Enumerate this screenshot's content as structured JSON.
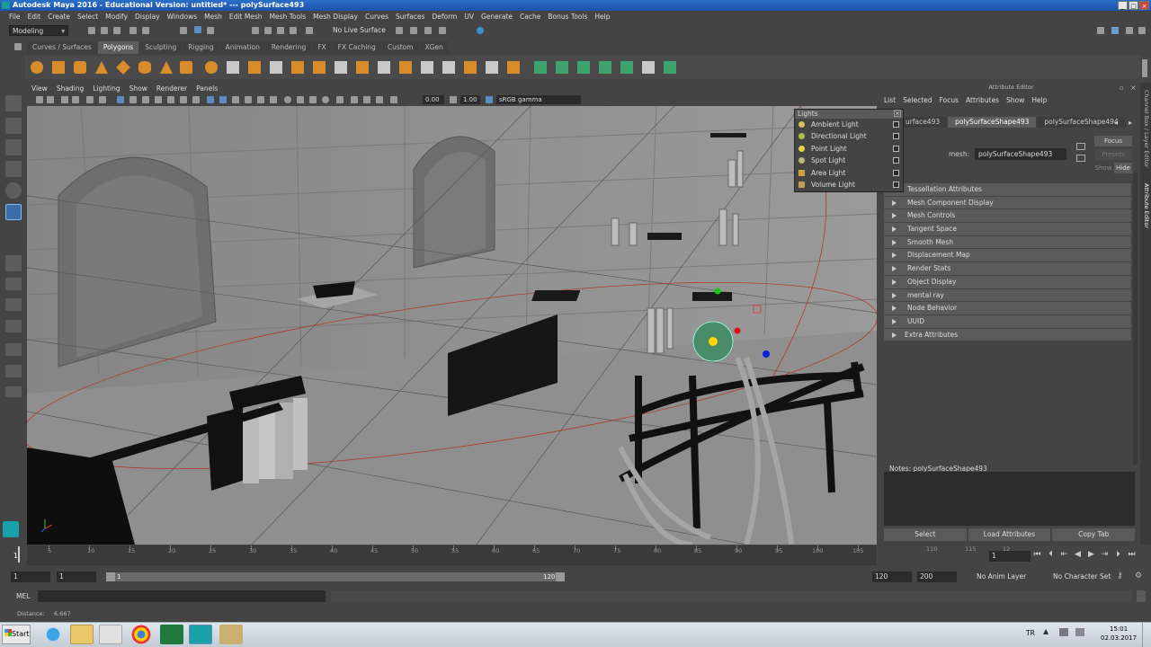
{
  "window": {
    "title": "Autodesk Maya 2016 - Educational Version: untitled*   ---   polySurface493"
  },
  "menubar": [
    "File",
    "Edit",
    "Create",
    "Select",
    "Modify",
    "Display",
    "Windows",
    "Mesh",
    "Edit Mesh",
    "Mesh Tools",
    "Mesh Display",
    "Curves",
    "Surfaces",
    "Deform",
    "UV",
    "Generate",
    "Cache",
    "Bonus Tools",
    "Help"
  ],
  "status": {
    "mode": "Modeling",
    "live_surface": "No Live Surface"
  },
  "shelf_tabs": [
    "Curves / Surfaces",
    "Polygons",
    "Sculpting",
    "Rigging",
    "Animation",
    "Rendering",
    "FX",
    "FX Caching",
    "Custom",
    "XGen"
  ],
  "shelf_active": "Polygons",
  "viewport_menu": [
    "View",
    "Shading",
    "Lighting",
    "Show",
    "Renderer",
    "Panels"
  ],
  "viewport_toolbar": {
    "exposure": "0.00",
    "gamma": "1.00",
    "color_space": "sRGB gamma"
  },
  "lights_panel": {
    "title": "Lights",
    "items": [
      "Ambient Light",
      "Directional Light",
      "Point Light",
      "Spot Light",
      "Area Light",
      "Volume Light"
    ]
  },
  "attribute_editor": {
    "title": "Attribute Editor",
    "menu": [
      "List",
      "Selected",
      "Focus",
      "Attributes",
      "Show",
      "Help"
    ],
    "tabs": [
      "urface493",
      "polySurfaceShape493",
      "polySurfaceShape494"
    ],
    "active_tab": "polySurfaceShape493",
    "mesh_label": "mesh:",
    "mesh_value": "polySurfaceShape493",
    "buttons": {
      "focus": "Focus",
      "presets": "Presets",
      "show": "Show",
      "hide": "Hide"
    },
    "sections": [
      "Tessellation Attributes",
      "Mesh Component Display",
      "Mesh Controls",
      "Tangent Space",
      "Smooth Mesh",
      "Displacement Map",
      "Render Stats",
      "Object Display",
      "mental ray",
      "Node Behavior",
      "UUID",
      "Extra Attributes"
    ],
    "notes_label": "Notes:  polySurfaceShape493",
    "bottom_buttons": [
      "Select",
      "Load Attributes",
      "Copy Tab"
    ]
  },
  "side_tabs": [
    "Channel Box / Layer Editor",
    "Attribute Editor"
  ],
  "timeline": {
    "ticks": [
      "5",
      "10",
      "15",
      "20",
      "25",
      "30",
      "35",
      "40",
      "45",
      "50",
      "55",
      "60",
      "65",
      "70",
      "75",
      "80",
      "85",
      "90",
      "95",
      "100",
      "105",
      "110",
      "115",
      "12"
    ],
    "current_frame_marker": "1",
    "current_frame_field": "1"
  },
  "range": {
    "start": "1",
    "playback_start": "1",
    "slider_start": "1",
    "slider_end": "120",
    "playback_end": "120",
    "end": "200",
    "anim_layer": "No Anim Layer",
    "character_set": "No Character Set"
  },
  "command_line": {
    "label": "MEL"
  },
  "help_line": {
    "label": "Distance:",
    "value": "6.667"
  },
  "taskbar": {
    "start": "Start",
    "lang": "TR",
    "time": "15:01",
    "date": "02.03.2017"
  }
}
